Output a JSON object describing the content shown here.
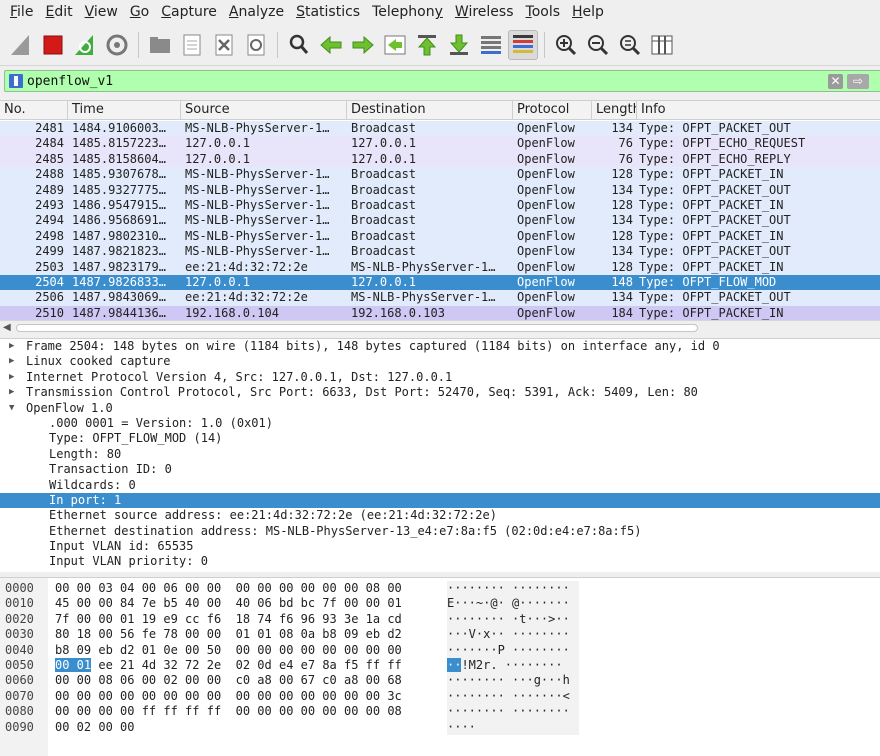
{
  "menu": [
    {
      "u": "F",
      "rest": "ile"
    },
    {
      "u": "E",
      "rest": "dit"
    },
    {
      "u": "V",
      "rest": "iew"
    },
    {
      "u": "G",
      "rest": "o"
    },
    {
      "u": "C",
      "rest": "apture"
    },
    {
      "u": "A",
      "rest": "nalyze"
    },
    {
      "u": "S",
      "rest": "tatistics"
    },
    {
      "u": "",
      "rest": "Telephon",
      "tail_u": "y"
    },
    {
      "u": "W",
      "rest": "ireless"
    },
    {
      "u": "T",
      "rest": "ools"
    },
    {
      "u": "H",
      "rest": "elp"
    }
  ],
  "toolbar": {
    "icons": [
      "shark-fin-start-icon",
      "stop-capture-icon",
      "restart-capture-icon",
      "capture-options-icon",
      "open-file-icon",
      "save-file-icon",
      "close-file-icon",
      "reload-file-icon",
      "find-packet-icon",
      "go-back-icon",
      "go-forward-icon",
      "go-to-packet-icon",
      "first-packet-icon",
      "last-packet-icon",
      "autoscroll-icon",
      "colorize-icon",
      "zoom-in-icon",
      "zoom-out-icon",
      "normal-size-icon",
      "resize-columns-icon"
    ],
    "pressed": "colorize-icon"
  },
  "filter": {
    "value": "openflow_v1",
    "clear_label": "✕",
    "apply_label": "⇨"
  },
  "packet_list": {
    "columns": [
      "No.",
      "Time",
      "Source",
      "Destination",
      "Protocol",
      "Length",
      "Info"
    ],
    "rows": [
      {
        "no": "2481",
        "time": "1484.9106003…",
        "src": "MS-NLB-PhysServer-1…",
        "dst": "Broadcast",
        "proto": "OpenFlow",
        "len": "134",
        "info": "Type: OFPT_PACKET_OUT",
        "style": "blue"
      },
      {
        "no": "2484",
        "time": "1485.8157223…",
        "src": "127.0.0.1",
        "dst": "127.0.0.1",
        "proto": "OpenFlow",
        "len": "76",
        "info": "Type: OFPT_ECHO_REQUEST",
        "style": "lav"
      },
      {
        "no": "2485",
        "time": "1485.8158604…",
        "src": "127.0.0.1",
        "dst": "127.0.0.1",
        "proto": "OpenFlow",
        "len": "76",
        "info": "Type: OFPT_ECHO_REPLY",
        "style": "lav"
      },
      {
        "no": "2488",
        "time": "1485.9307678…",
        "src": "MS-NLB-PhysServer-1…",
        "dst": "Broadcast",
        "proto": "OpenFlow",
        "len": "128",
        "info": "Type: OFPT_PACKET_IN",
        "style": "blue"
      },
      {
        "no": "2489",
        "time": "1485.9327775…",
        "src": "MS-NLB-PhysServer-1…",
        "dst": "Broadcast",
        "proto": "OpenFlow",
        "len": "134",
        "info": "Type: OFPT_PACKET_OUT",
        "style": "blue"
      },
      {
        "no": "2493",
        "time": "1486.9547915…",
        "src": "MS-NLB-PhysServer-1…",
        "dst": "Broadcast",
        "proto": "OpenFlow",
        "len": "128",
        "info": "Type: OFPT_PACKET_IN",
        "style": "blue"
      },
      {
        "no": "2494",
        "time": "1486.9568691…",
        "src": "MS-NLB-PhysServer-1…",
        "dst": "Broadcast",
        "proto": "OpenFlow",
        "len": "134",
        "info": "Type: OFPT_PACKET_OUT",
        "style": "blue"
      },
      {
        "no": "2498",
        "time": "1487.9802310…",
        "src": "MS-NLB-PhysServer-1…",
        "dst": "Broadcast",
        "proto": "OpenFlow",
        "len": "128",
        "info": "Type: OFPT_PACKET_IN",
        "style": "blue"
      },
      {
        "no": "2499",
        "time": "1487.9821823…",
        "src": "MS-NLB-PhysServer-1…",
        "dst": "Broadcast",
        "proto": "OpenFlow",
        "len": "134",
        "info": "Type: OFPT_PACKET_OUT",
        "style": "blue"
      },
      {
        "no": "2503",
        "time": "1487.9823179…",
        "src": "ee:21:4d:32:72:2e",
        "dst": "MS-NLB-PhysServer-1…",
        "proto": "OpenFlow",
        "len": "128",
        "info": "Type: OFPT_PACKET_IN",
        "style": "blue"
      },
      {
        "no": "2504",
        "time": "1487.9826833…",
        "src": "127.0.0.1",
        "dst": "127.0.0.1",
        "proto": "OpenFlow",
        "len": "148",
        "info": "Type: OFPT_FLOW_MOD",
        "style": "selected"
      },
      {
        "no": "2506",
        "time": "1487.9843069…",
        "src": "ee:21:4d:32:72:2e",
        "dst": "MS-NLB-PhysServer-1…",
        "proto": "OpenFlow",
        "len": "134",
        "info": "Type: OFPT_PACKET_OUT",
        "style": "blue"
      },
      {
        "no": "2510",
        "time": "1487.9844136…",
        "src": "192.168.0.104",
        "dst": "192.168.0.103",
        "proto": "OpenFlow",
        "len": "184",
        "info": "Type: OFPT_PACKET_IN",
        "style": "purple"
      }
    ]
  },
  "details": [
    {
      "text": "Frame 2504: 148 bytes on wire (1184 bits), 148 bytes captured (1184 bits) on interface any, id 0",
      "level": 0,
      "twisty": "▶"
    },
    {
      "text": "Linux cooked capture",
      "level": 0,
      "twisty": "▶"
    },
    {
      "text": "Internet Protocol Version 4, Src: 127.0.0.1, Dst: 127.0.0.1",
      "level": 0,
      "twisty": "▶"
    },
    {
      "text": "Transmission Control Protocol, Src Port: 6633, Dst Port: 52470, Seq: 5391, Ack: 5409, Len: 80",
      "level": 0,
      "twisty": "▶"
    },
    {
      "text": "OpenFlow 1.0",
      "level": 0,
      "twisty": "▼"
    },
    {
      "text": ".000 0001 = Version: 1.0 (0x01)",
      "level": 1,
      "twisty": ""
    },
    {
      "text": "Type: OFPT_FLOW_MOD (14)",
      "level": 1,
      "twisty": ""
    },
    {
      "text": "Length: 80",
      "level": 1,
      "twisty": ""
    },
    {
      "text": "Transaction ID: 0",
      "level": 1,
      "twisty": ""
    },
    {
      "text": "Wildcards: 0",
      "level": 1,
      "twisty": ""
    },
    {
      "text": "In port: 1",
      "level": 1,
      "twisty": "",
      "selected": true
    },
    {
      "text": "Ethernet source address: ee:21:4d:32:72:2e (ee:21:4d:32:72:2e)",
      "level": 1,
      "twisty": ""
    },
    {
      "text": "Ethernet destination address: MS-NLB-PhysServer-13_e4:e7:8a:f5 (02:0d:e4:e7:8a:f5)",
      "level": 1,
      "twisty": ""
    },
    {
      "text": "Input VLAN id: 65535",
      "level": 1,
      "twisty": ""
    },
    {
      "text": "Input VLAN priority: 0",
      "level": 1,
      "twisty": ""
    }
  ],
  "bytes": [
    {
      "off": "0000",
      "hex": "00 00 03 04 00 06 00 00  00 00 00 00 00 00 08 00",
      "ascii": "········ ········"
    },
    {
      "off": "0010",
      "hex": "45 00 00 84 7e b5 40 00  40 06 bd bc 7f 00 00 01",
      "ascii": "E···~·@· @·······"
    },
    {
      "off": "0020",
      "hex": "7f 00 00 01 19 e9 cc f6  18 74 f6 96 93 3e 1a cd",
      "ascii": "········ ·t···>··"
    },
    {
      "off": "0030",
      "hex": "80 18 00 56 fe 78 00 00  01 01 08 0a b8 09 eb d2",
      "ascii": "···V·x·· ········"
    },
    {
      "off": "0040",
      "hex": "b8 09 eb d2 01 0e 00 50  00 00 00 00 00 00 00 00",
      "ascii": "·······P ········"
    },
    {
      "off": "0050",
      "hex_hl": "00 01",
      "hex": " ee 21 4d 32 72 2e  02 0d e4 e7 8a f5 ff ff",
      "ascii_hl": "··",
      "ascii": "!M2r. ········"
    },
    {
      "off": "0060",
      "hex": "00 00 08 06 00 02 00 00  c0 a8 00 67 c0 a8 00 68",
      "ascii": "········ ···g···h"
    },
    {
      "off": "0070",
      "hex": "00 00 00 00 00 00 00 00  00 00 00 00 00 00 00 3c",
      "ascii": "········ ·······<"
    },
    {
      "off": "0080",
      "hex": "00 00 00 00 ff ff ff ff  00 00 00 00 00 00 00 08",
      "ascii": "········ ········"
    },
    {
      "off": "0090",
      "hex": "00 02 00 00",
      "ascii": "····"
    }
  ]
}
